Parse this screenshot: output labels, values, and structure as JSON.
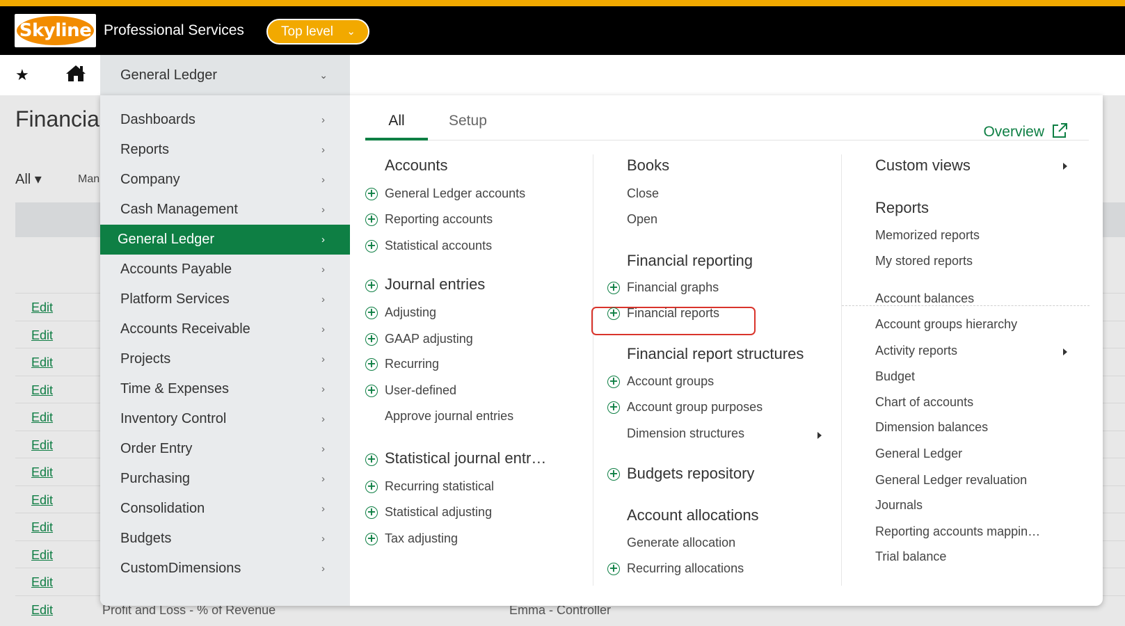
{
  "brand": {
    "logo_text": "Skyline",
    "app_title": "Professional Services",
    "level_button": "Top level"
  },
  "nav": {
    "module": "General Ledger"
  },
  "background": {
    "title": "Financia",
    "filter": "All",
    "filter_partial": "Man",
    "visible_row_text": "Profit and Loss - % of Revenue",
    "visible_row_owner": "Emma - Controller",
    "edit_label": "Edit"
  },
  "menu": {
    "items": [
      {
        "label": "Dashboards",
        "active": false
      },
      {
        "label": "Reports",
        "active": false
      },
      {
        "label": "Company",
        "active": false
      },
      {
        "label": "Cash Management",
        "active": false
      },
      {
        "label": "General Ledger",
        "active": true
      },
      {
        "label": "Accounts Payable",
        "active": false
      },
      {
        "label": "Platform Services",
        "active": false
      },
      {
        "label": "Accounts Receivable",
        "active": false
      },
      {
        "label": "Projects",
        "active": false
      },
      {
        "label": "Time & Expenses",
        "active": false
      },
      {
        "label": "Inventory Control",
        "active": false
      },
      {
        "label": "Order Entry",
        "active": false
      },
      {
        "label": "Purchasing",
        "active": false
      },
      {
        "label": "Consolidation",
        "active": false
      },
      {
        "label": "Budgets",
        "active": false
      },
      {
        "label": "CustomDimensions",
        "active": false
      }
    ]
  },
  "tabs": {
    "all": "All",
    "setup": "Setup",
    "overview": "Overview"
  },
  "columns": {
    "col1": {
      "accounts": {
        "title": "Accounts",
        "items": [
          "General Ledger accounts",
          "Reporting accounts",
          "Statistical accounts"
        ]
      },
      "journal": {
        "title": "Journal entries",
        "items": [
          "Adjusting",
          "GAAP adjusting",
          "Recurring",
          "User-defined",
          "Approve journal entries"
        ]
      },
      "stat": {
        "title": "Statistical journal entr…",
        "items": [
          "Recurring statistical",
          "Statistical adjusting",
          "Tax adjusting"
        ]
      }
    },
    "col2": {
      "books": {
        "title": "Books",
        "items": [
          "Close",
          "Open"
        ]
      },
      "freport": {
        "title": "Financial reporting",
        "items": [
          "Financial graphs",
          "Financial reports"
        ]
      },
      "fstruct": {
        "title": "Financial report structures",
        "items": [
          "Account groups",
          "Account group purposes",
          "Dimension structures"
        ]
      },
      "budgets": {
        "title": "Budgets repository"
      },
      "alloc": {
        "title": "Account allocations",
        "items": [
          "Generate allocation",
          "Recurring allocations"
        ]
      }
    },
    "col3": {
      "custom": {
        "title": "Custom views"
      },
      "reports": {
        "title": "Reports",
        "items": [
          "Memorized reports",
          "My stored reports"
        ]
      },
      "list": [
        "Account balances",
        "Account groups hierarchy",
        "Activity reports",
        "Budget",
        "Chart of accounts",
        "Dimension balances",
        "General Ledger",
        "General Ledger revaluation",
        "Journals",
        "Reporting accounts mappin…",
        "Trial balance"
      ]
    }
  },
  "colors": {
    "brand_green": "#0e7f44",
    "brand_orange": "#f2a900",
    "highlight_red": "#d9342b"
  }
}
